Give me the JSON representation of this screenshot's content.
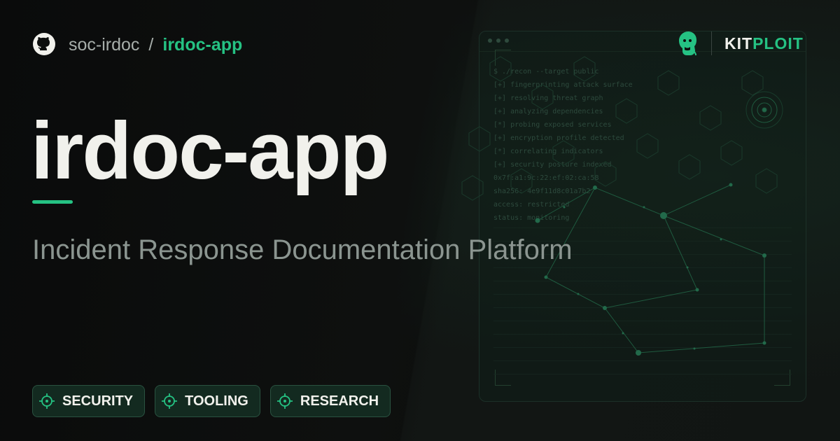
{
  "header": {
    "owner": "soc-irdoc",
    "separator": "/",
    "repo": "irdoc-app"
  },
  "brand": {
    "part1": "KIT",
    "part2": "PLOIT",
    "accent": "#25c283"
  },
  "hero": {
    "title": "irdoc-app",
    "subtitle": "Incident Response Documentation Platform"
  },
  "tags": [
    {
      "label": "SECURITY",
      "icon": "crosshair-icon"
    },
    {
      "label": "TOOLING",
      "icon": "crosshair-icon"
    },
    {
      "label": "RESEARCH",
      "icon": "crosshair-icon"
    }
  ],
  "terminal": {
    "lines": [
      "$ ./recon --target public",
      "[+] fingerprinting attack surface",
      "[+] resolving threat graph",
      "[+] analyzing dependencies",
      "[*] probing exposed services",
      "[+] encryption profile detected",
      "[*] correlating indicators",
      "[+] security posture indexed",
      "0x7f:a1:9c:22:ef:02:ca:58",
      "sha256: 4e9f11d8c01a7b2",
      "access: restricted",
      "status: monitoring"
    ]
  },
  "colors": {
    "background": "#0c0e0d",
    "text": "#f1f1ec",
    "muted": "#8b9590",
    "accent": "#25c283"
  }
}
